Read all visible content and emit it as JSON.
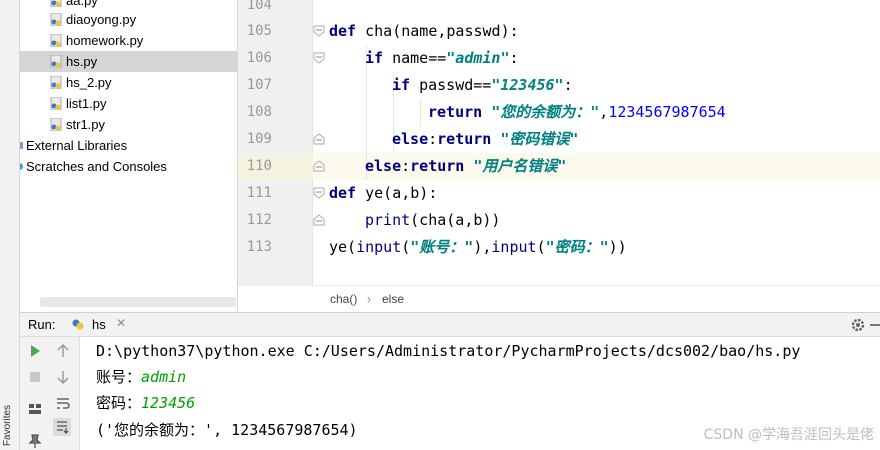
{
  "project_tree": {
    "files": [
      {
        "label": "aa.py"
      },
      {
        "label": "diaoyong.py"
      },
      {
        "label": "homework.py"
      },
      {
        "label": "hs.py",
        "selected": true
      },
      {
        "label": "hs_2.py"
      },
      {
        "label": "list1.py"
      },
      {
        "label": "str1.py"
      }
    ],
    "external_libraries": "External Libraries",
    "scratches": "Scratches and Consoles"
  },
  "editor": {
    "line_numbers": [
      "104",
      "105",
      "106",
      "107",
      "108",
      "109",
      "110",
      "111",
      "112",
      "113"
    ],
    "code": {
      "l105_kw": "def",
      "l105_rest": " cha(name,passwd):",
      "l106_kw": "if",
      "l106_mid": " name==",
      "l106_str": "\"admin\"",
      "l106_end": ":",
      "l107_kw": "if",
      "l107_mid": " passwd==",
      "l107_str": "\"123456\"",
      "l107_end": ":",
      "l108_kw": "return",
      "l108_sp": " ",
      "l108_str": "\"您的余额为：\"",
      "l108_comma": ",",
      "l108_num": "1234567987654",
      "l109_kw1": "else",
      "l109_colon": ":",
      "l109_kw2": "return",
      "l109_sp": " ",
      "l109_str": "\"密码错误\"",
      "l110_kw1": "else",
      "l110_colon": ":",
      "l110_kw2": "return",
      "l110_sp": " ",
      "l110_str": "\"用户名错误\"",
      "l111_kw": "def",
      "l111_rest": " ye(a,b):",
      "l112_bi": "print",
      "l112_rest": "(cha(a,b))",
      "l113_a": "ye(",
      "l113_bi1": "input",
      "l113_b": "(",
      "l113_str1": "\"账号：\"",
      "l113_c": "),",
      "l113_bi2": "input",
      "l113_d": "(",
      "l113_str2": "\"密码：\"",
      "l113_e": "))"
    },
    "breadcrumb": [
      "cha()",
      "›",
      "else"
    ]
  },
  "run_panel": {
    "title": "Run:",
    "tab_label": "hs",
    "tab_close": "✕"
  },
  "console": {
    "command": "D:\\python37\\python.exe C:/Users/Administrator/PycharmProjects/dcs002/bao/hs.py",
    "prompt_account": "账号：",
    "input_account": "admin",
    "prompt_password": "密码：",
    "input_password": "123456",
    "result": "('您的余额为：', 1234567987654)"
  },
  "favorites_tab": "Favorites",
  "watermark": "CSDN @学海吾涯回头是佬",
  "colors": {
    "keyword": "#000080",
    "string": "#008080",
    "number": "#0000ff",
    "input_echo": "#00a000",
    "selection": "#d5d5d5",
    "current_line": "#fcfaed"
  }
}
